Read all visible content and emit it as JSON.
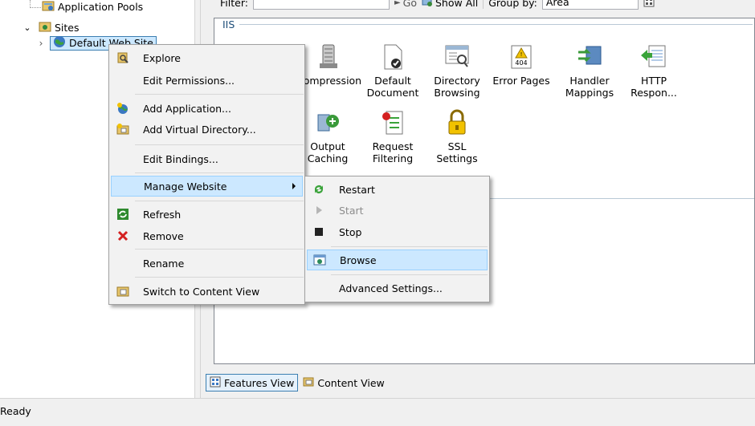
{
  "tree": {
    "app_pools_label": "Application Pools",
    "sites_label": "Sites",
    "default_site_label": "Default Web Site"
  },
  "toolbar": {
    "filter_label": "Filter:",
    "go_label": "Go",
    "show_all_label": "Show All",
    "group_by_label": "Group by:",
    "group_by_value": "Area"
  },
  "section": {
    "title": "IIS"
  },
  "features": [
    {
      "label": "Compression",
      "icon": "compression-icon"
    },
    {
      "label": "Default Document",
      "icon": "default-document-icon"
    },
    {
      "label": "Directory Browsing",
      "icon": "directory-browsing-icon"
    },
    {
      "label": "Error Pages",
      "icon": "error-pages-icon",
      "badge": "404"
    },
    {
      "label": "Handler Mappings",
      "icon": "handler-mappings-icon"
    },
    {
      "label": "HTTP Respon...",
      "icon": "http-response-icon"
    },
    {
      "label": "Output Caching",
      "icon": "output-caching-icon"
    },
    {
      "label": "Request Filtering",
      "icon": "request-filtering-icon"
    },
    {
      "label": "SSL Settings",
      "icon": "ssl-settings-icon"
    }
  ],
  "context_menu": {
    "items": [
      {
        "label": "Explore",
        "icon": "explore-icon"
      },
      {
        "label": "Edit Permissions...",
        "icon": ""
      },
      {
        "label": "Add Application...",
        "icon": "add-application-icon"
      },
      {
        "label": "Add Virtual Directory...",
        "icon": "add-virtual-directory-icon"
      },
      {
        "label": "Edit Bindings...",
        "icon": ""
      },
      {
        "label": "Manage Website",
        "icon": "",
        "submenu": true
      },
      {
        "label": "Refresh",
        "icon": "refresh-icon"
      },
      {
        "label": "Remove",
        "icon": "remove-icon"
      },
      {
        "label": "Rename",
        "icon": ""
      },
      {
        "label": "Switch to Content View",
        "icon": "content-view-icon"
      }
    ]
  },
  "submenu": {
    "items": [
      {
        "label": "Restart",
        "icon": "restart-icon"
      },
      {
        "label": "Start",
        "icon": "start-icon",
        "disabled": true
      },
      {
        "label": "Stop",
        "icon": "stop-icon"
      },
      {
        "label": "Browse",
        "icon": "browse-icon",
        "highlighted": true
      },
      {
        "label": "Advanced Settings...",
        "icon": ""
      }
    ]
  },
  "bottom_tabs": {
    "features_view": "Features View",
    "content_view": "Content View"
  },
  "status": {
    "text": "Ready"
  },
  "colors": {
    "highlight": "#cce8ff",
    "highlight_border": "#99d1ff",
    "remove_red": "#d42020",
    "section_text": "#1e4e79"
  }
}
